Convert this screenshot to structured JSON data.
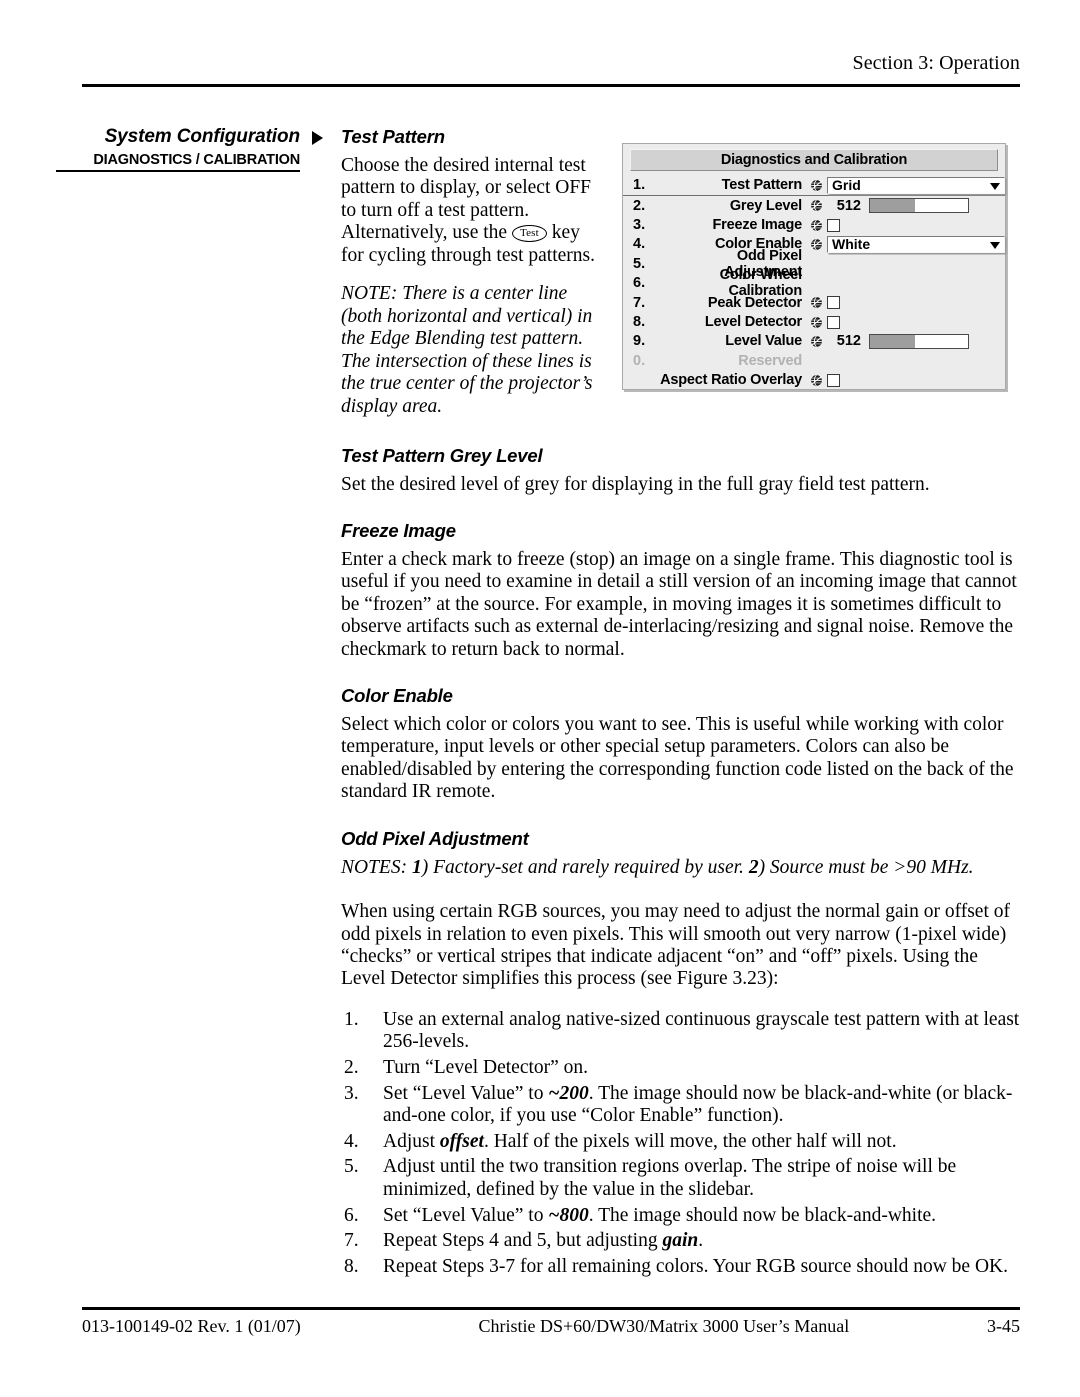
{
  "header": {
    "section_label": "Section 3: Operation"
  },
  "sidebar": {
    "title": "System Configuration",
    "subtitle": "DIAGNOSTICS / CALIBRATION"
  },
  "sections": {
    "test_pattern": {
      "heading": "Test Pattern",
      "body_part1": "Choose the desired internal test pattern to display, or select OFF to turn off a test pattern. Alternatively, use the",
      "key_label": "Test",
      "body_part2": "key for cycling through test patterns.",
      "note": "NOTE: There is a center line (both horizontal and vertical) in the Edge Blending test pattern. The intersection of these lines is the true center of the projector’s display area."
    },
    "grey_level": {
      "heading": "Test Pattern Grey Level",
      "body": "Set the desired level of grey for displaying in the full gray field test pattern."
    },
    "freeze_image": {
      "heading": "Freeze Image",
      "body": "Enter a check mark to freeze (stop) an image on a single frame. This diagnostic tool is useful if you need to examine in detail a still version of an incoming image that cannot be “frozen” at the source. For example, in moving images it is sometimes difficult to observe artifacts such as external de-interlacing/resizing and signal noise. Remove the checkmark to return back to normal."
    },
    "color_enable": {
      "heading": "Color Enable",
      "body": "Select which color or colors you want to see. This is useful while working with color temperature, input levels or other special setup parameters. Colors can also be enabled/disabled by entering the corresponding function code listed on the back of the standard IR remote."
    },
    "odd_pixel": {
      "heading": "Odd Pixel Adjustment",
      "notes_prefix": "NOTES: ",
      "notes_num1": "1",
      "notes_text1": ") Factory-set and rarely required by user. ",
      "notes_num2": "2",
      "notes_text2": ") Source must be >90 MHz.",
      "body": "When using certain RGB sources, you may need to adjust the normal gain or offset of odd pixels in relation to even pixels. This will smooth out very narrow (1-pixel wide) “checks” or vertical stripes that indicate adjacent “on” and “off” pixels. Using the Level Detector simplifies this process (see Figure 3.23):"
    }
  },
  "steps": [
    {
      "num": "1.",
      "pre": "Use an external analog native-sized continuous grayscale test pattern with at least 256-levels.",
      "em": "",
      "post": ""
    },
    {
      "num": "2.",
      "pre": "Turn “Level Detector” on.",
      "em": "",
      "post": ""
    },
    {
      "num": "3.",
      "pre": "Set “Level Value” to ",
      "em": "~200",
      "post": ". The image should now be black-and-white (or black-and-one color, if you use “Color Enable” function)."
    },
    {
      "num": "4.",
      "pre": "Adjust ",
      "em": "offset",
      "post": ". Half of the pixels will move, the other half will not."
    },
    {
      "num": "5.",
      "pre": "Adjust until the two transition regions overlap. The stripe of noise will be minimized, defined by the value in the slidebar.",
      "em": "",
      "post": ""
    },
    {
      "num": "6.",
      "pre": "Set “Level Value” to ",
      "em": "~800",
      "post": ". The image should now be black-and-white."
    },
    {
      "num": "7.",
      "pre": "Repeat Steps 4 and 5, but adjusting ",
      "em": "gain",
      "post": "."
    },
    {
      "num": "8.",
      "pre": "Repeat Steps 3-7 for all remaining colors. Your RGB source should now be OK.",
      "em": "",
      "post": ""
    }
  ],
  "osd": {
    "title": "Diagnostics and Calibration",
    "rows": [
      {
        "num": "1.",
        "label": "Test Pattern",
        "control": "dropdown",
        "value": "Grid"
      },
      {
        "num": "2.",
        "label": "Grey Level",
        "control": "slider",
        "value": "512"
      },
      {
        "num": "3.",
        "label": "Freeze Image",
        "control": "checkbox",
        "value": ""
      },
      {
        "num": "4.",
        "label": "Color Enable",
        "control": "dropdown",
        "value": "White"
      },
      {
        "num": "5.",
        "label": "Odd Pixel Adjustment",
        "control": "none",
        "value": ""
      },
      {
        "num": "6.",
        "label": "Color Wheel Calibration",
        "control": "none",
        "value": ""
      },
      {
        "num": "7.",
        "label": "Peak Detector",
        "control": "checkbox",
        "value": ""
      },
      {
        "num": "8.",
        "label": "Level Detector",
        "control": "checkbox",
        "value": ""
      },
      {
        "num": "9.",
        "label": "Level Value",
        "control": "slider",
        "value": "512"
      },
      {
        "num": "0.",
        "label": "Reserved",
        "control": "none",
        "value": ""
      },
      {
        "num": "",
        "label": "Aspect Ratio Overlay",
        "control": "checkbox",
        "value": ""
      }
    ],
    "icon_name": "globe-icon"
  },
  "footer": {
    "left": "013-100149-02 Rev. 1 (01/07)",
    "center": "Christie DS+60/DW30/Matrix 3000 User’s Manual",
    "right": "3-45"
  }
}
